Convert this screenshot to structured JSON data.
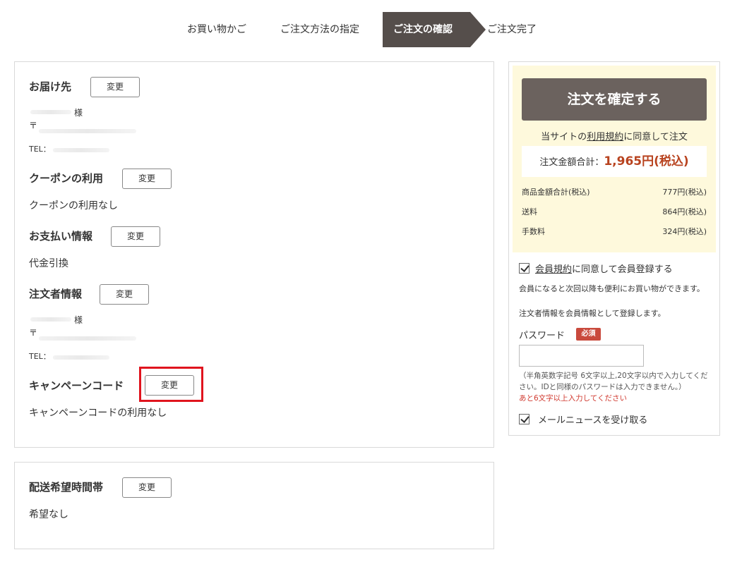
{
  "steps": {
    "cart": "お買い物かご",
    "method": "ご注文方法の指定",
    "confirm": "ご注文の確認",
    "complete": "ご注文完了"
  },
  "change_label": "変更",
  "sections": {
    "delivery_address": {
      "title": "お届け先",
      "sama": "様",
      "postal": "〒",
      "tel": "TEL："
    },
    "coupon": {
      "title": "クーポンの利用",
      "value": "クーポンの利用なし"
    },
    "payment": {
      "title": "お支払い情報",
      "value": "代金引換"
    },
    "orderer": {
      "title": "注文者情報",
      "sama": "様",
      "postal": "〒",
      "tel": "TEL："
    },
    "campaign": {
      "title": "キャンペーンコード",
      "value": "キャンペーンコードの利用なし"
    },
    "delivery_time": {
      "title": "配送希望時間帯",
      "value": "希望なし"
    }
  },
  "summary": {
    "confirm_button": "注文を確定する",
    "agree_prefix": "当サイトの",
    "terms_link": "利用規約",
    "agree_suffix": "に同意して注文",
    "total_label": "注文金額合計：",
    "total_value": "1,965円(税込)",
    "rows": [
      {
        "label": "商品金額合計(税込)",
        "value": "777円(税込)"
      },
      {
        "label": "送料",
        "value": "864円(税込)"
      },
      {
        "label": "手数料",
        "value": "324円(税込)"
      }
    ]
  },
  "membership": {
    "member_terms_link": "会員規約",
    "register_suffix": "に同意して会員登録する",
    "register_checked": true,
    "desc1": "会員になると次回以降も便利にお買い物ができます。",
    "desc2": "注文者情報を会員情報として登録します。",
    "password_label": "パスワード",
    "required_badge": "必須",
    "password_value": "",
    "note": "（半角英数字記号 6文字以上,20文字以内で入力してください。IDと同様のパスワードは入力できません。）",
    "warning": "あと6文字以上入力してください",
    "newsletter_label": "メールニュースを受け取る",
    "newsletter_checked": true
  },
  "colors": {
    "active_step": "#554e4b",
    "confirm_button": "#6b625e",
    "total_value": "#b8431f",
    "summary_bg": "#fef9dc",
    "highlight": "#e0141e",
    "required_badge": "#c94a3d"
  }
}
